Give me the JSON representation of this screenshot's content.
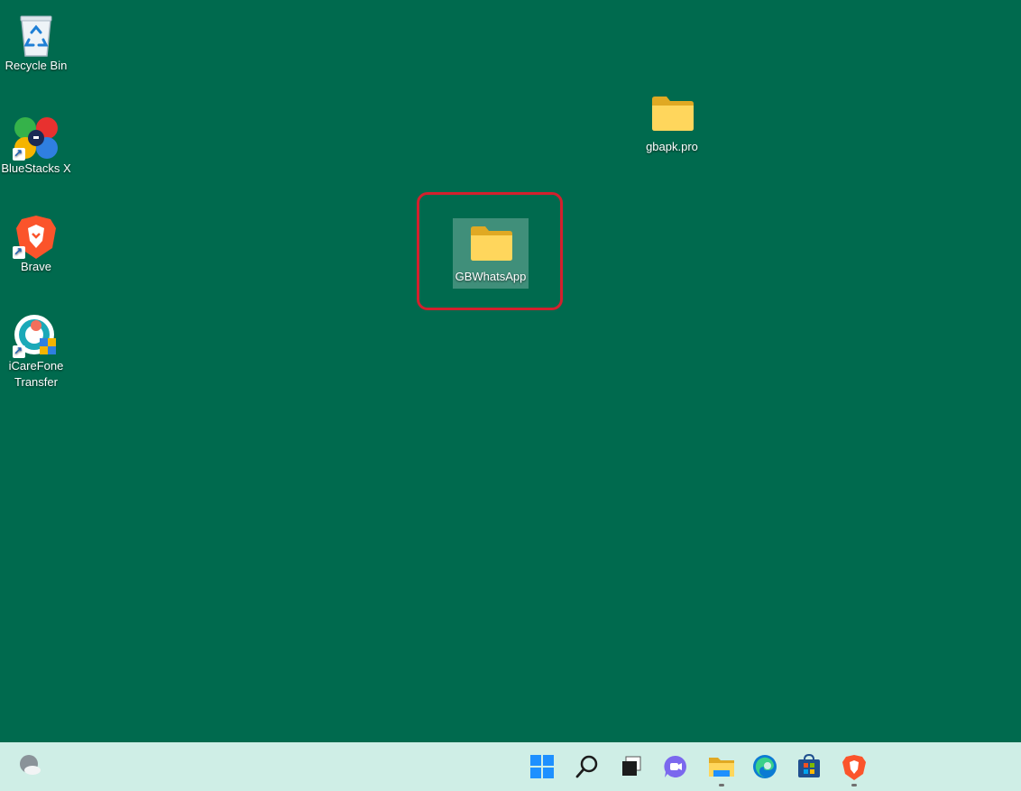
{
  "desktop": {
    "background_color": "#006a4e",
    "icons": [
      {
        "label": "Recycle Bin",
        "icon": "recycle-bin-icon"
      },
      {
        "label": "BlueStacks X",
        "icon": "bluestacks-icon"
      },
      {
        "label": "Brave",
        "icon": "brave-icon"
      },
      {
        "label": "iCareFone\nTransfer",
        "icon": "icarefone-icon"
      },
      {
        "label": "gbapk.pro",
        "icon": "folder-icon"
      },
      {
        "label": "GBWhatsApp",
        "icon": "folder-icon",
        "selected": true
      }
    ],
    "highlight_color": "#d3202d"
  },
  "taskbar": {
    "background_color": "#cfeee6",
    "items": [
      {
        "name": "widgets",
        "icon": "weather-widget-icon"
      },
      {
        "name": "start",
        "icon": "windows-start-icon"
      },
      {
        "name": "search",
        "icon": "search-icon"
      },
      {
        "name": "task-view",
        "icon": "task-view-icon"
      },
      {
        "name": "teams-chat",
        "icon": "chat-icon"
      },
      {
        "name": "file-explorer",
        "icon": "file-explorer-icon",
        "running": true
      },
      {
        "name": "edge",
        "icon": "edge-icon"
      },
      {
        "name": "store",
        "icon": "store-icon"
      },
      {
        "name": "brave",
        "icon": "brave-icon",
        "running": true
      }
    ]
  }
}
